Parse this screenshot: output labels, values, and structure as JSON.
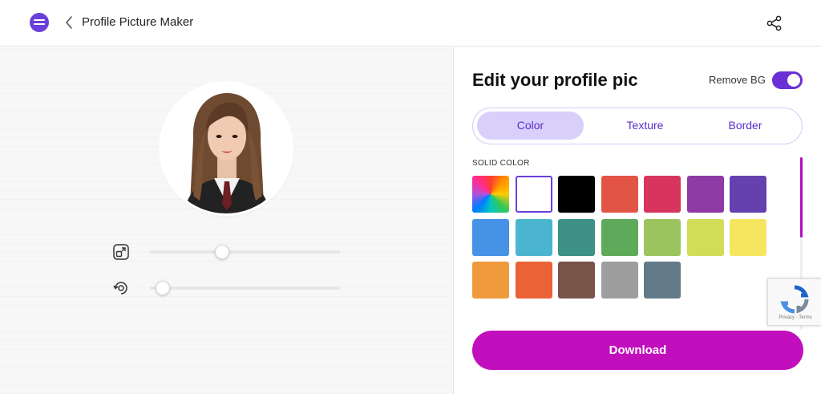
{
  "header": {
    "title": "Profile Picture Maker"
  },
  "editor": {
    "heading": "Edit your profile pic",
    "remove_bg_label": "Remove BG",
    "remove_bg_enabled": true,
    "tabs": [
      {
        "label": "Color",
        "active": true
      },
      {
        "label": "Texture",
        "active": false
      },
      {
        "label": "Border",
        "active": false
      }
    ],
    "solid_color_label": "SOLID COLOR",
    "swatches": [
      {
        "name": "rainbow",
        "color": "conic-gradient"
      },
      {
        "name": "white",
        "color": "#ffffff",
        "selected": true
      },
      {
        "name": "black",
        "color": "#000000"
      },
      {
        "name": "red",
        "color": "#e25444"
      },
      {
        "name": "pink",
        "color": "#d7355e"
      },
      {
        "name": "purple",
        "color": "#8e3ba6"
      },
      {
        "name": "deep-purple",
        "color": "#6541b0"
      },
      {
        "name": "blue",
        "color": "#4592e6"
      },
      {
        "name": "cyan",
        "color": "#4bb5cf"
      },
      {
        "name": "teal",
        "color": "#3d9186"
      },
      {
        "name": "green",
        "color": "#5fa95a"
      },
      {
        "name": "light-green",
        "color": "#9bc45e"
      },
      {
        "name": "lime",
        "color": "#d3dc58"
      },
      {
        "name": "yellow",
        "color": "#f6e55e"
      },
      {
        "name": "orange",
        "color": "#ef9a3c"
      },
      {
        "name": "deep-orange",
        "color": "#ea6236"
      },
      {
        "name": "brown",
        "color": "#785449"
      },
      {
        "name": "grey",
        "color": "#9e9e9e"
      },
      {
        "name": "blue-grey",
        "color": "#637a89"
      }
    ],
    "download_label": "Download"
  },
  "preview": {
    "zoom_level": 0.37,
    "rotation_level": 0.03
  },
  "recaptcha": {
    "text": "Privacy - Terms"
  },
  "colors": {
    "accent": "#6b3fd9",
    "download": "#c20fbd",
    "tab_active_bg": "#d9cffb"
  },
  "icons": {
    "logo": "app-logo-icon",
    "back": "chevron-left-icon",
    "share": "share-icon",
    "zoom": "zoom-scale-icon",
    "rotate": "rotate-icon"
  }
}
